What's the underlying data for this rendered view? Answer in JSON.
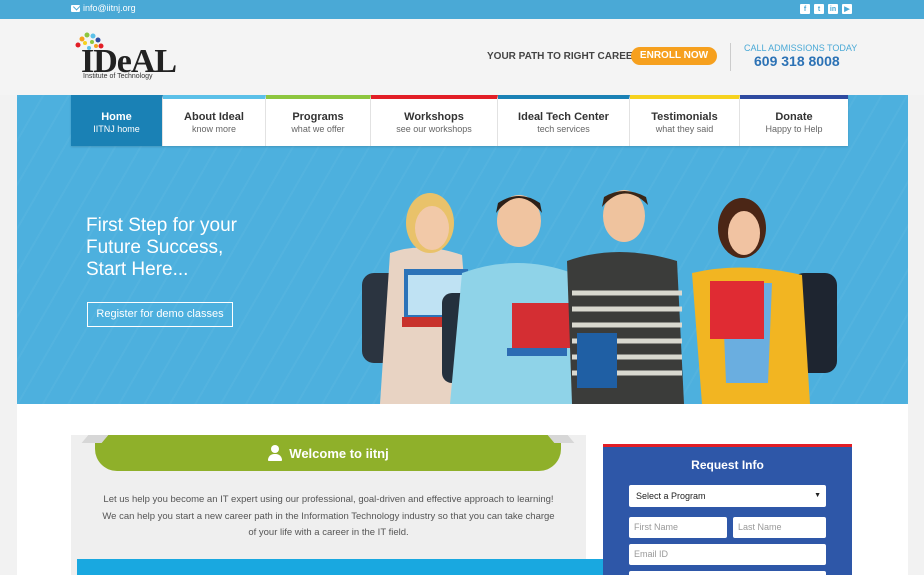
{
  "topbar": {
    "email": "info@iitnj.org",
    "social": [
      "facebook-icon",
      "twitter-icon",
      "linkedin-icon",
      "youtube-icon"
    ]
  },
  "header": {
    "logo_word": "IDeAL",
    "logo_sub": "Institute of Technology",
    "tagline": "YOUR PATH TO RIGHT CAREER",
    "enroll_label": "ENROLL NOW",
    "call_label": "CALL ADMISSIONS TODAY",
    "call_number": "609 318 8008"
  },
  "nav": [
    {
      "title": "Home",
      "sub": "IITNJ home",
      "color": "#1a81b5",
      "active": true
    },
    {
      "title": "About Ideal",
      "sub": "know more",
      "color": "#5bc0e8"
    },
    {
      "title": "Programs",
      "sub": "what we offer",
      "color": "#8dc63f"
    },
    {
      "title": "Workshops",
      "sub": "see our workshops",
      "color": "#e21e26"
    },
    {
      "title": "Ideal Tech Center",
      "sub": "tech services",
      "color": "#1a81b5"
    },
    {
      "title": "Testimonials",
      "sub": "what they said",
      "color": "#f6d21e"
    },
    {
      "title": "Donate",
      "sub": "Happy to Help",
      "color": "#2e4aa0"
    }
  ],
  "hero": {
    "headline": [
      "First Step for your",
      "Future Success,",
      "Start Here..."
    ],
    "register_label": "Register for demo classes"
  },
  "welcome": {
    "title": "Welcome to iitnj",
    "body": "Let us help you become an IT expert using our professional, goal-driven and effective approach to learning! We can help you start a new career path in the Information Technology industry so that you can take charge of your life with a career in the IT field."
  },
  "request": {
    "title": "Request Info",
    "program_select": "Select a Program",
    "first_name": "First Name",
    "last_name": "Last Name",
    "email": "Email ID"
  }
}
